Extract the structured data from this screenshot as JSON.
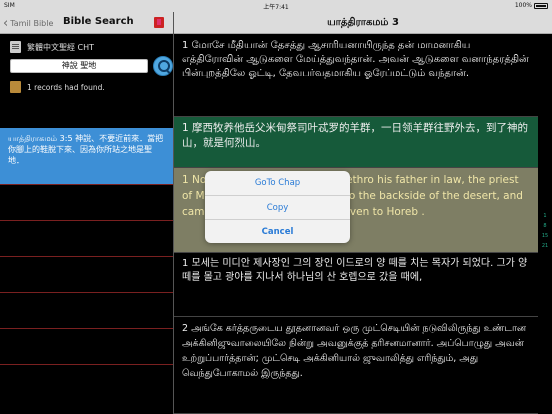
{
  "status": {
    "carrier": "SIM",
    "time": "上午7:41",
    "battery": "100%"
  },
  "left_header": {
    "back_label": "Tamil Bible",
    "title": "Bible Search"
  },
  "search": {
    "version_label": "繁體中文聖經 CHT",
    "query": "神說 聖地",
    "records_text": "1 records had found."
  },
  "results": [
    {
      "text": "யாத்திராகமம் 3:5 神說、不要近前來．當把你腳上的鞋脫下來、因為你所站之地是聖地．"
    }
  ],
  "right_header": {
    "title": "யாத்திராகமம் 3"
  },
  "verses": [
    {
      "text": "1 மோசே மீதியான் தேசத்து ஆசாரியனாயிருந்த தன் மாமனாகிய எத்திரோவின் ஆடுகளை மேய்த்துவந்தான். அவன் ஆடுகளை வனாந்தரத்தின் பின்புறத்திலே ஓட்டி, தேவபர்வதமாகிய ஓரேப்மட்டும் வந்தான்."
    },
    {
      "text": "1 摩西牧养他岳父米甸祭司叶忒罗的羊群，一日领羊群往野外去，到了神的山，就是何烈山。"
    },
    {
      "text": "1 Now Moses kept the flock of Jethro his father in law, the priest of Midian: and he led the flock to the backside of the desert, and came to the mountain of God, even to Horeb ."
    },
    {
      "text": "1 모세는 미디안 제사장인 그의 장인 이드로의 양 떼를 치는 목자가 되었다. 그가 양 떼를 몰고 광야를 지나서 하나님의 산 호렙으로 갔을 때에,"
    },
    {
      "text": "2 அங்கே கர்த்தருடைய தூதனானவர் ஒரு முட்செடியின் நடுவிலிருந்து உண்டான அக்கினிஜுவாலையிலே நின்று அவனுக்குத் தரிசனமானார். அப்பொழுது அவன் உற்றுப்பார்த்தான்; முட்செடி அக்கினியால் ஜுவாலித்து எரிந்தும், அது வெந்துபோகாமல் இருந்தது."
    }
  ],
  "index": [
    "1",
    "8",
    "15",
    "21"
  ],
  "popup": {
    "goto": "GoTo Chap",
    "copy": "Copy",
    "cancel": "Cancel"
  }
}
